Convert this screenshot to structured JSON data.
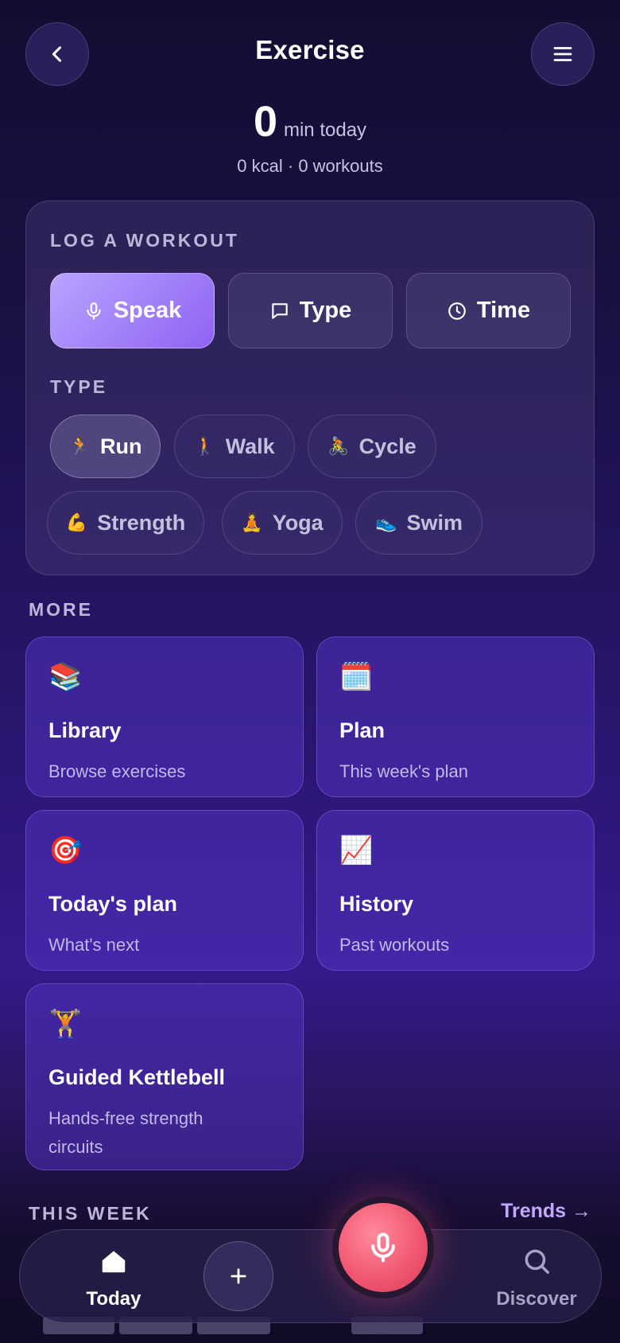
{
  "header": {
    "title": "Exercise"
  },
  "summary": {
    "minutes": "0",
    "unit": "min today",
    "details": "0 kcal · 0 workouts"
  },
  "log": {
    "section_label": "LOG A WORKOUT",
    "modes": [
      {
        "label": "Speak",
        "icon": "mic-icon",
        "active": true
      },
      {
        "label": "Type",
        "icon": "chat-icon",
        "active": false
      },
      {
        "label": "Time",
        "icon": "clock-icon",
        "active": false
      }
    ],
    "type_label": "TYPE",
    "types": [
      {
        "label": "Run",
        "emoji": "🏃",
        "active": true
      },
      {
        "label": "Walk",
        "emoji": "🚶",
        "active": false
      },
      {
        "label": "Cycle",
        "emoji": "🚴",
        "active": false
      },
      {
        "label": "Strength",
        "emoji": "💪",
        "active": false
      },
      {
        "label": "Yoga",
        "emoji": "🧘",
        "active": false
      },
      {
        "label": "Swim",
        "emoji": "👟",
        "active": false
      }
    ]
  },
  "more": {
    "section_label": "MORE",
    "tiles": [
      {
        "title": "Library",
        "subtitle": "Browse exercises",
        "emoji": "📚"
      },
      {
        "title": "Plan",
        "subtitle": "This week's plan",
        "emoji": "🗓️"
      },
      {
        "title": "Today's plan",
        "subtitle": "What's next",
        "emoji": "🎯"
      },
      {
        "title": "History",
        "subtitle": "Past workouts",
        "emoji": "📈"
      },
      {
        "title": "Guided Kettlebell",
        "subtitle": "Hands-free strength circuits",
        "emoji": "🏋️"
      }
    ]
  },
  "week": {
    "section_label": "THIS WEEK",
    "trends_link": "Trends →"
  },
  "nav": {
    "today": "Today",
    "discover": "Discover"
  },
  "colors": {
    "accent": "#8e63f3",
    "mic": "#f0546f",
    "link": "#c3a8ff"
  }
}
